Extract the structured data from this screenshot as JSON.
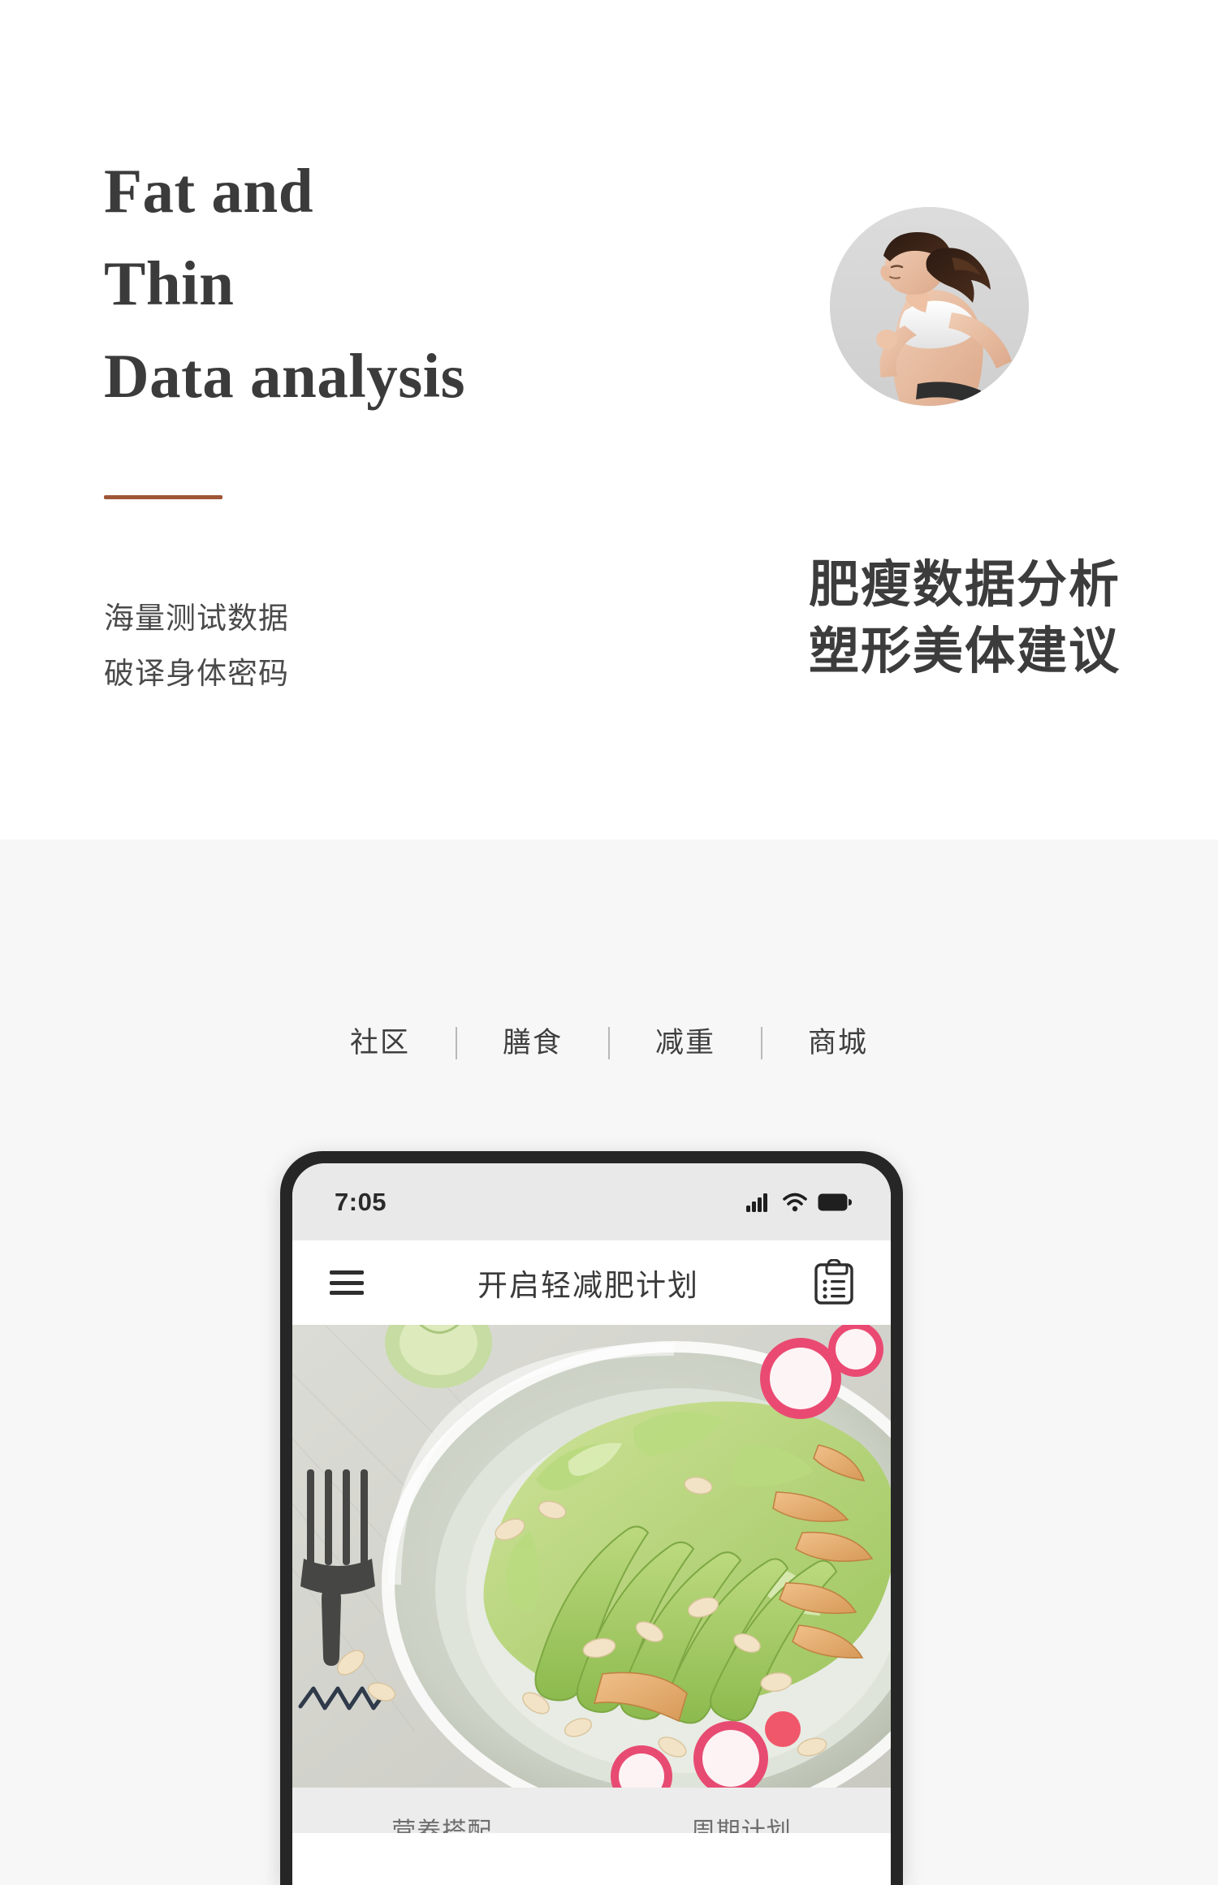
{
  "hero": {
    "title": "Fat and\nThin\nData analysis",
    "divider_color": "#9e5636",
    "subtitle": "海量测试数据\n破译身体密码",
    "cn_heading": "肥瘦数据分析\n塑形美体建议",
    "photo_alt": "running-woman-circular-photo"
  },
  "nav": {
    "tabs": [
      {
        "label": "社区"
      },
      {
        "label": "膳食"
      },
      {
        "label": "减重"
      },
      {
        "label": "商城"
      }
    ],
    "separator": "|"
  },
  "phone": {
    "statusbar": {
      "time": "7:05",
      "icons": [
        "signal-icon",
        "wifi-icon",
        "battery-icon"
      ]
    },
    "appbar": {
      "menu_icon": "hamburger-menu-icon",
      "title": "开启轻减肥计划",
      "action_icon": "clipboard-icon"
    },
    "content": {
      "photo_alt": "salad-bowl-photo",
      "below_items": [
        {
          "label": "营养搭配"
        },
        {
          "label": "周期计划"
        }
      ]
    }
  },
  "colors": {
    "hero_bg": "#ffffff",
    "section_bg": "#f7f7f7",
    "accent": "#9e5636",
    "text_dark": "#3b3b3b",
    "phone_frame": "#262626",
    "statusbar_bg": "#e9e9e9"
  }
}
